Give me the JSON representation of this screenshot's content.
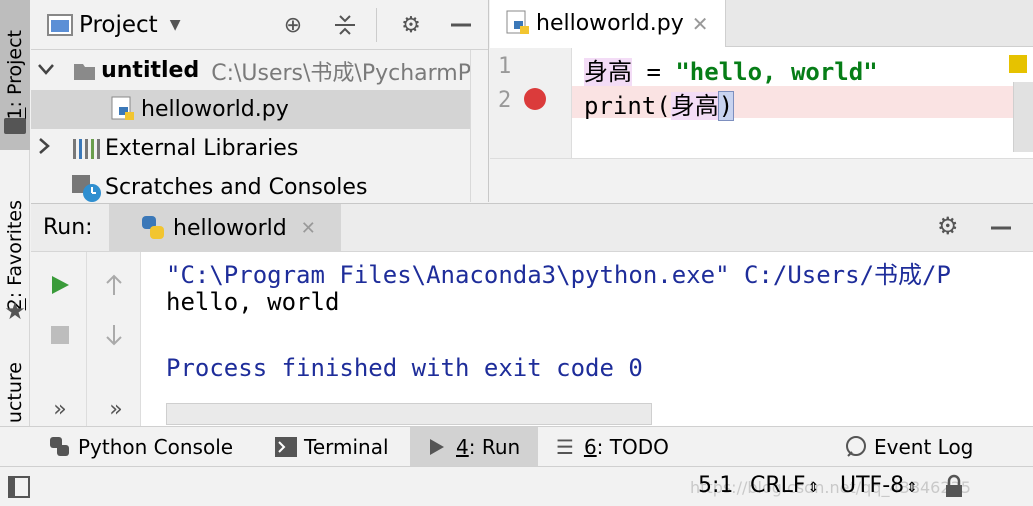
{
  "left_strip": {
    "project_tab": {
      "key": "1",
      "label": ": Project"
    },
    "favorites_tab": {
      "key": "2",
      "label": ": Favorites"
    },
    "structure_tab": {
      "label": "ucture"
    }
  },
  "project_panel": {
    "title": "Project",
    "tree": [
      {
        "name": "untitled",
        "path": "C:\\Users\\书成\\PycharmP"
      },
      {
        "name": "helloworld.py"
      },
      {
        "name": "External Libraries"
      },
      {
        "name": "Scratches and Consoles"
      }
    ]
  },
  "editor": {
    "tab_label": "helloworld.py",
    "lines": [
      {
        "number": "1",
        "var": "身高",
        "op": " = ",
        "string": "\"hello, world\""
      },
      {
        "number": "2",
        "func": "print(",
        "var": "身高",
        "close": ")"
      }
    ]
  },
  "run": {
    "label": "Run:",
    "tab_label": "helloworld",
    "console": [
      "\"C:\\Program Files\\Anaconda3\\python.exe\" C:/Users/书成/P",
      "hello, world",
      "",
      "Process finished with exit code 0"
    ],
    "more_glyph": "»"
  },
  "bottom_tabs": {
    "python_console": "Python Console",
    "terminal": "Terminal",
    "run_key": "4",
    "run_label": ": Run",
    "todo_key": "6",
    "todo_label": ": TODO",
    "event_log": "Event Log"
  },
  "status": {
    "position": "5:1",
    "line_sep": "CRLF",
    "encoding": "UTF-8",
    "watermark": "https://blog.csdn.net/qq_43846235"
  },
  "colors": {
    "breakpoint": "#db3b3b",
    "string": "#067d17",
    "console_info": "#1e2d9a",
    "run_green": "#3a9b3a"
  }
}
